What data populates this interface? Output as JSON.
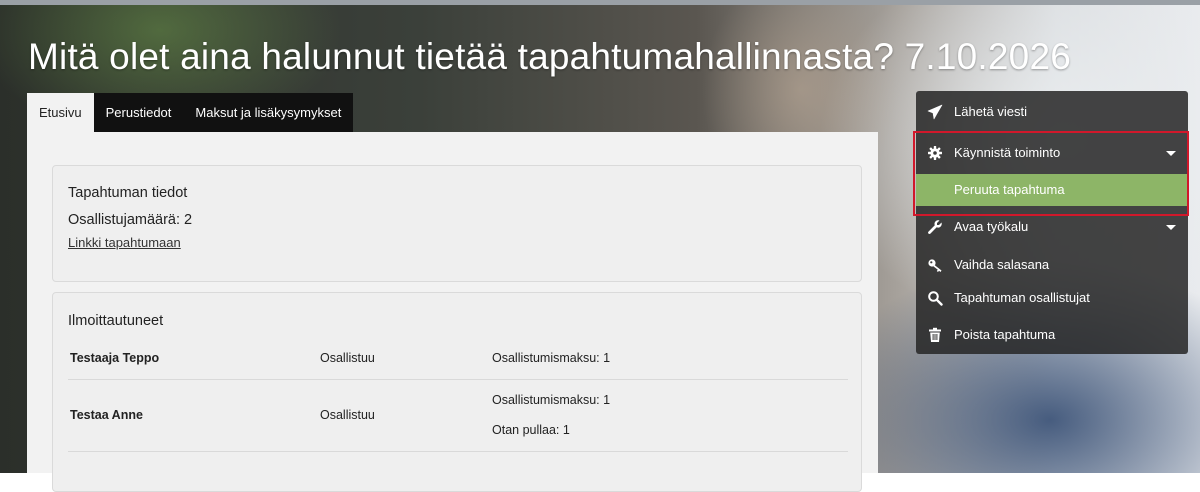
{
  "page": {
    "title": "Mitä olet aina halunnut tietää tapahtumahallinnasta? 7.10.2026"
  },
  "tabs": [
    {
      "label": "Etusivu",
      "active": true
    },
    {
      "label": "Perustiedot",
      "active": false
    },
    {
      "label": "Maksut ja lisäkysymykset",
      "active": false
    }
  ],
  "event_info": {
    "title": "Tapahtuman tiedot",
    "participant_count": "Osallistujamäärä: 2",
    "link_label": "Linkki tapahtumaan"
  },
  "registrations": {
    "title": "Ilmoittautuneet",
    "rows": [
      {
        "name": "Testaaja Teppo",
        "status": "Osallistuu",
        "extras": [
          "Osallistumismaksu: 1"
        ]
      },
      {
        "name": "Testaa Anne",
        "status": "Osallistuu",
        "extras": [
          "Osallistumismaksu: 1",
          "Otan pullaa: 1"
        ]
      }
    ]
  },
  "action_menu": {
    "items": [
      {
        "label": "Lähetä viesti",
        "icon": "send-icon"
      },
      {
        "label": "Käynnistä toiminto",
        "icon": "gear-icon",
        "expanded": true
      },
      {
        "label": "Peruuta tapahtuma",
        "icon": "",
        "submenu": true,
        "highlighted": true
      },
      {
        "label": "Avaa työkalu",
        "icon": "wrench-icon"
      },
      {
        "label": "Vaihda salasana",
        "icon": "key-icon"
      },
      {
        "label": "Tapahtuman osallistujat",
        "icon": "search-icon"
      },
      {
        "label": "Poista tapahtuma",
        "icon": "trash-icon"
      }
    ]
  },
  "colors": {
    "submenu_highlight": "#8db567",
    "annotation_border": "#d1182b",
    "menu_background": "#262626",
    "tab_bar": "#111111"
  }
}
